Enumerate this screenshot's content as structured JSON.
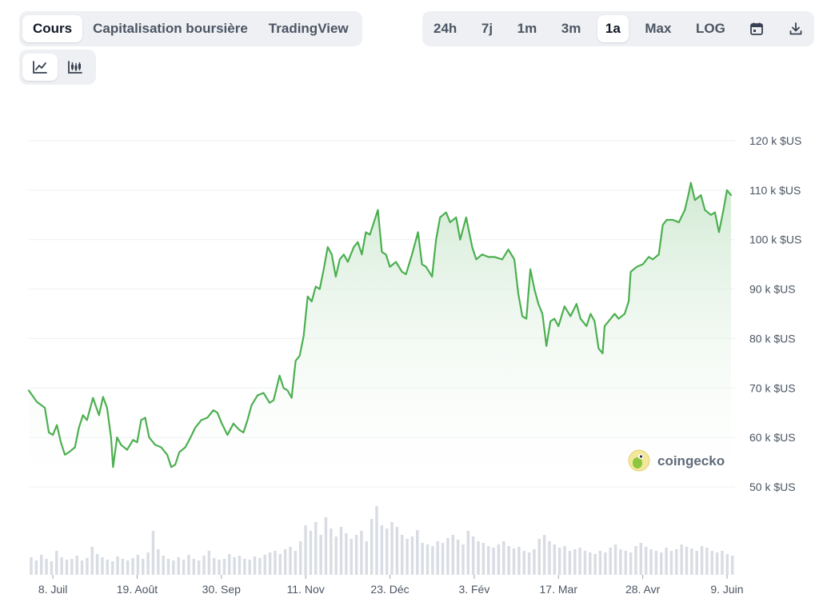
{
  "tabs": {
    "view": [
      {
        "label": "Cours",
        "active": true
      },
      {
        "label": "Capitalisation boursière",
        "active": false
      },
      {
        "label": "TradingView",
        "active": false
      }
    ],
    "range": [
      {
        "label": "24h",
        "active": false
      },
      {
        "label": "7j",
        "active": false
      },
      {
        "label": "1m",
        "active": false
      },
      {
        "label": "3m",
        "active": false
      },
      {
        "label": "1a",
        "active": true
      },
      {
        "label": "Max",
        "active": false
      },
      {
        "label": "LOG",
        "active": false
      }
    ],
    "range_icons": [
      "calendar-icon",
      "download-icon"
    ],
    "chart_style_icons": [
      "line-chart-icon",
      "candlestick-chart-icon"
    ]
  },
  "watermark": {
    "text": "coingecko",
    "icon": "coingecko-logo-icon"
  },
  "colors": {
    "line": "#4caf50",
    "fill_top": "#cfe9d1",
    "grid": "#eceff3",
    "volume": "#d9dde3",
    "axis_text": "#4b5563"
  },
  "chart_data": {
    "type": "area",
    "title": "",
    "xlabel": "",
    "ylabel": "",
    "ylim": [
      50000,
      120000
    ],
    "y_ticks": [
      {
        "value": 120000,
        "label": "120 k $US"
      },
      {
        "value": 110000,
        "label": "110 k $US"
      },
      {
        "value": 100000,
        "label": "100 k $US"
      },
      {
        "value": 90000,
        "label": "90 k $US"
      },
      {
        "value": 80000,
        "label": "80 k $US"
      },
      {
        "value": 70000,
        "label": "70 k $US"
      },
      {
        "value": 60000,
        "label": "60 k $US"
      },
      {
        "value": 50000,
        "label": "50 k $US"
      }
    ],
    "xlim": [
      "2024-06-26",
      "2025-06-13"
    ],
    "x_ticks": [
      {
        "date": "2024-07-08",
        "label": "8. Juil"
      },
      {
        "date": "2024-08-19",
        "label": "19. Août"
      },
      {
        "date": "2024-09-30",
        "label": "30. Sep"
      },
      {
        "date": "2024-11-11",
        "label": "11. Nov"
      },
      {
        "date": "2024-12-23",
        "label": "23. Déc"
      },
      {
        "date": "2025-02-03",
        "label": "3. Fév"
      },
      {
        "date": "2025-03-17",
        "label": "17. Mar"
      },
      {
        "date": "2025-04-28",
        "label": "28. Avr"
      },
      {
        "date": "2025-06-09",
        "label": "9. Juin"
      }
    ],
    "grid": true,
    "series": [
      {
        "points": [
          [
            "2024-06-26",
            69500
          ],
          [
            "2024-06-30",
            67200
          ],
          [
            "2024-07-04",
            66000
          ],
          [
            "2024-07-06",
            61000
          ],
          [
            "2024-07-08",
            60500
          ],
          [
            "2024-07-10",
            62500
          ],
          [
            "2024-07-12",
            59000
          ],
          [
            "2024-07-14",
            56500
          ],
          [
            "2024-07-16",
            57000
          ],
          [
            "2024-07-19",
            58000
          ],
          [
            "2024-07-21",
            62000
          ],
          [
            "2024-07-23",
            64500
          ],
          [
            "2024-07-25",
            63500
          ],
          [
            "2024-07-28",
            68000
          ],
          [
            "2024-07-31",
            64500
          ],
          [
            "2024-08-02",
            68200
          ],
          [
            "2024-08-04",
            66000
          ],
          [
            "2024-08-06",
            60000
          ],
          [
            "2024-08-07",
            54000
          ],
          [
            "2024-08-09",
            60000
          ],
          [
            "2024-08-11",
            58500
          ],
          [
            "2024-08-14",
            57500
          ],
          [
            "2024-08-17",
            59500
          ],
          [
            "2024-08-19",
            59000
          ],
          [
            "2024-08-21",
            63500
          ],
          [
            "2024-08-23",
            64000
          ],
          [
            "2024-08-25",
            60000
          ],
          [
            "2024-08-28",
            58500
          ],
          [
            "2024-08-31",
            58000
          ],
          [
            "2024-09-03",
            56500
          ],
          [
            "2024-09-05",
            54000
          ],
          [
            "2024-09-07",
            54500
          ],
          [
            "2024-09-09",
            57000
          ],
          [
            "2024-09-12",
            58000
          ],
          [
            "2024-09-14",
            59500
          ],
          [
            "2024-09-17",
            62000
          ],
          [
            "2024-09-20",
            63500
          ],
          [
            "2024-09-23",
            64000
          ],
          [
            "2024-09-26",
            65500
          ],
          [
            "2024-09-28",
            65000
          ],
          [
            "2024-09-30",
            63000
          ],
          [
            "2024-10-03",
            60500
          ],
          [
            "2024-10-06",
            62800
          ],
          [
            "2024-10-09",
            61500
          ],
          [
            "2024-10-11",
            61000
          ],
          [
            "2024-10-13",
            63500
          ],
          [
            "2024-10-15",
            66500
          ],
          [
            "2024-10-18",
            68500
          ],
          [
            "2024-10-21",
            69000
          ],
          [
            "2024-10-24",
            67000
          ],
          [
            "2024-10-26",
            67500
          ],
          [
            "2024-10-29",
            72500
          ],
          [
            "2024-10-31",
            70000
          ],
          [
            "2024-11-02",
            69500
          ],
          [
            "2024-11-04",
            68000
          ],
          [
            "2024-11-06",
            75500
          ],
          [
            "2024-11-08",
            76500
          ],
          [
            "2024-11-10",
            80500
          ],
          [
            "2024-11-12",
            88500
          ],
          [
            "2024-11-14",
            87500
          ],
          [
            "2024-11-16",
            90500
          ],
          [
            "2024-11-18",
            90000
          ],
          [
            "2024-11-20",
            94000
          ],
          [
            "2024-11-22",
            98500
          ],
          [
            "2024-11-24",
            97000
          ],
          [
            "2024-11-26",
            92500
          ],
          [
            "2024-11-28",
            96000
          ],
          [
            "2024-11-30",
            97000
          ],
          [
            "2024-12-02",
            95500
          ],
          [
            "2024-12-05",
            98500
          ],
          [
            "2024-12-07",
            99500
          ],
          [
            "2024-12-09",
            97000
          ],
          [
            "2024-12-11",
            101500
          ],
          [
            "2024-12-13",
            101000
          ],
          [
            "2024-12-15",
            103500
          ],
          [
            "2024-12-17",
            106000
          ],
          [
            "2024-12-19",
            97500
          ],
          [
            "2024-12-21",
            97000
          ],
          [
            "2024-12-23",
            94500
          ],
          [
            "2024-12-26",
            95500
          ],
          [
            "2024-12-29",
            93500
          ],
          [
            "2024-12-31",
            93000
          ],
          [
            "2025-01-03",
            97000
          ],
          [
            "2025-01-06",
            101500
          ],
          [
            "2025-01-08",
            95000
          ],
          [
            "2025-01-10",
            94500
          ],
          [
            "2025-01-13",
            92500
          ],
          [
            "2025-01-15",
            100000
          ],
          [
            "2025-01-17",
            104500
          ],
          [
            "2025-01-20",
            105500
          ],
          [
            "2025-01-22",
            103500
          ],
          [
            "2025-01-25",
            104500
          ],
          [
            "2025-01-27",
            100000
          ],
          [
            "2025-01-30",
            104500
          ],
          [
            "2025-02-02",
            98500
          ],
          [
            "2025-02-04",
            96000
          ],
          [
            "2025-02-07",
            97000
          ],
          [
            "2025-02-10",
            96500
          ],
          [
            "2025-02-13",
            96500
          ],
          [
            "2025-02-17",
            96000
          ],
          [
            "2025-02-20",
            98000
          ],
          [
            "2025-02-23",
            96000
          ],
          [
            "2025-02-25",
            89000
          ],
          [
            "2025-02-27",
            84500
          ],
          [
            "2025-03-01",
            84000
          ],
          [
            "2025-03-03",
            94000
          ],
          [
            "2025-03-05",
            90000
          ],
          [
            "2025-03-07",
            87000
          ],
          [
            "2025-03-09",
            85000
          ],
          [
            "2025-03-11",
            78500
          ],
          [
            "2025-03-13",
            83500
          ],
          [
            "2025-03-15",
            84000
          ],
          [
            "2025-03-17",
            82500
          ],
          [
            "2025-03-20",
            86500
          ],
          [
            "2025-03-23",
            84500
          ],
          [
            "2025-03-26",
            87000
          ],
          [
            "2025-03-28",
            84000
          ],
          [
            "2025-03-31",
            82500
          ],
          [
            "2025-04-02",
            85000
          ],
          [
            "2025-04-04",
            83500
          ],
          [
            "2025-04-06",
            78000
          ],
          [
            "2025-04-08",
            77000
          ],
          [
            "2025-04-09",
            82500
          ],
          [
            "2025-04-11",
            83500
          ],
          [
            "2025-04-14",
            85000
          ],
          [
            "2025-04-16",
            84000
          ],
          [
            "2025-04-19",
            85000
          ],
          [
            "2025-04-21",
            87500
          ],
          [
            "2025-04-22",
            93500
          ],
          [
            "2025-04-25",
            94500
          ],
          [
            "2025-04-28",
            95000
          ],
          [
            "2025-05-01",
            96500
          ],
          [
            "2025-05-03",
            96000
          ],
          [
            "2025-05-06",
            97000
          ],
          [
            "2025-05-08",
            103000
          ],
          [
            "2025-05-10",
            104000
          ],
          [
            "2025-05-13",
            104000
          ],
          [
            "2025-05-16",
            103500
          ],
          [
            "2025-05-19",
            106000
          ],
          [
            "2025-05-21",
            109500
          ],
          [
            "2025-05-22",
            111500
          ],
          [
            "2025-05-24",
            108000
          ],
          [
            "2025-05-27",
            109000
          ],
          [
            "2025-05-29",
            106000
          ],
          [
            "2025-06-01",
            105000
          ],
          [
            "2025-06-03",
            105500
          ],
          [
            "2025-06-05",
            101500
          ],
          [
            "2025-06-07",
            105500
          ],
          [
            "2025-06-09",
            110000
          ],
          [
            "2025-06-11",
            109000
          ]
        ]
      }
    ],
    "volume": {
      "description_free": true,
      "relative_bars": [
        0.22,
        0.18,
        0.25,
        0.2,
        0.17,
        0.3,
        0.22,
        0.19,
        0.2,
        0.24,
        0.18,
        0.21,
        0.35,
        0.26,
        0.22,
        0.19,
        0.17,
        0.23,
        0.2,
        0.18,
        0.21,
        0.25,
        0.2,
        0.28,
        0.55,
        0.32,
        0.24,
        0.2,
        0.18,
        0.22,
        0.19,
        0.25,
        0.2,
        0.18,
        0.24,
        0.3,
        0.21,
        0.19,
        0.2,
        0.26,
        0.22,
        0.24,
        0.2,
        0.19,
        0.23,
        0.21,
        0.25,
        0.28,
        0.3,
        0.26,
        0.32,
        0.35,
        0.3,
        0.42,
        0.62,
        0.55,
        0.66,
        0.5,
        0.72,
        0.58,
        0.48,
        0.6,
        0.52,
        0.45,
        0.5,
        0.55,
        0.42,
        0.7,
        0.86,
        0.62,
        0.58,
        0.66,
        0.6,
        0.5,
        0.45,
        0.48,
        0.56,
        0.4,
        0.38,
        0.36,
        0.42,
        0.4,
        0.46,
        0.5,
        0.44,
        0.38,
        0.55,
        0.48,
        0.42,
        0.4,
        0.36,
        0.34,
        0.38,
        0.42,
        0.36,
        0.33,
        0.35,
        0.3,
        0.28,
        0.32,
        0.45,
        0.5,
        0.42,
        0.38,
        0.34,
        0.36,
        0.3,
        0.32,
        0.34,
        0.3,
        0.28,
        0.26,
        0.3,
        0.28,
        0.34,
        0.38,
        0.32,
        0.3,
        0.28,
        0.36,
        0.4,
        0.35,
        0.32,
        0.3,
        0.28,
        0.34,
        0.3,
        0.32,
        0.38,
        0.35,
        0.33,
        0.3,
        0.36,
        0.34,
        0.3,
        0.28,
        0.3,
        0.26,
        0.24
      ]
    }
  }
}
